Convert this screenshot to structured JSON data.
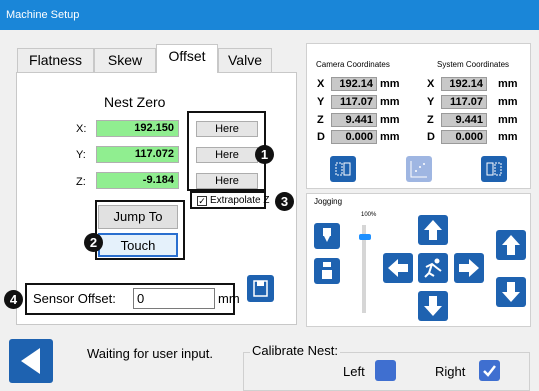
{
  "window": {
    "title": "Machine Setup"
  },
  "tabs": [
    {
      "label": "Flatness",
      "active": false
    },
    {
      "label": "Skew",
      "active": false
    },
    {
      "label": "Offset",
      "active": true
    },
    {
      "label": "Valve",
      "active": false
    }
  ],
  "offset": {
    "heading": "Nest Zero",
    "rows": [
      {
        "axis": "X:",
        "value": "192.150",
        "button": "Here"
      },
      {
        "axis": "Y:",
        "value": "117.072",
        "button": "Here"
      },
      {
        "axis": "Z:",
        "value": "-9.184",
        "button": "Here"
      }
    ],
    "extrapolate_label": "Extrapolate Z",
    "extrapolate_checked": true,
    "jump_to_label": "Jump To",
    "touch_label": "Touch",
    "sensor_offset_label": "Sensor Offset:",
    "sensor_offset_value": "0",
    "sensor_offset_unit": "mm"
  },
  "callouts": {
    "c1": "1",
    "c2": "2",
    "c3": "3",
    "c4": "4"
  },
  "coordinates": {
    "camera_title": "Camera Coordinates",
    "system_title": "System Coordinates",
    "unit": "mm",
    "rows": [
      {
        "axis": "X",
        "camera": "192.14",
        "system": "192.14"
      },
      {
        "axis": "Y",
        "camera": "117.07",
        "system": "117.07"
      },
      {
        "axis": "Z",
        "camera": "9.441",
        "system": "9.441"
      },
      {
        "axis": "D",
        "camera": "0.000",
        "system": "0.000"
      }
    ]
  },
  "jogging": {
    "title": "Jogging",
    "speed_label": "100%",
    "speed_percent": 100
  },
  "status": {
    "message": "Waiting for user input."
  },
  "calibrate": {
    "title": "Calibrate Nest:",
    "left_label": "Left",
    "right_label": "Right",
    "left_checked": false,
    "right_checked": true
  },
  "colors": {
    "title_bar": "#1a86d8",
    "value_green": "#90ee90",
    "accent_blue": "#1e62b0",
    "checkbox_blue": "#3f6fd0"
  }
}
